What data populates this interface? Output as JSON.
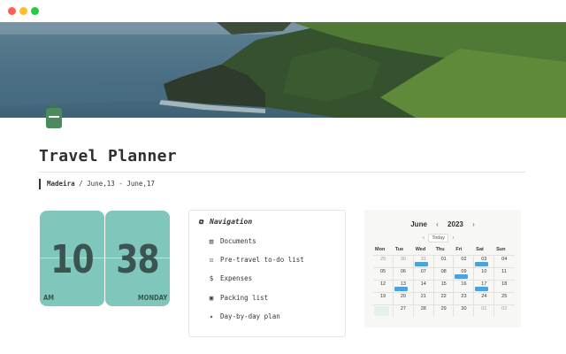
{
  "window": {
    "controls": [
      "close",
      "minimize",
      "zoom"
    ]
  },
  "cover": {
    "image": "coastal-cliffs-photo"
  },
  "page": {
    "icon": "backpack-icon",
    "title": "Travel Planner",
    "destination": "Madeira",
    "dates": " / June,13 - June,17"
  },
  "clock": {
    "hours": "10",
    "minutes": "38",
    "period": "AM",
    "day": "MONDAY"
  },
  "navigation": {
    "heading": "Navigation",
    "items": [
      {
        "label": "Documents",
        "icon": "document-icon"
      },
      {
        "label": "Pre-travel to-do list",
        "icon": "checklist-icon"
      },
      {
        "label": "Expenses",
        "icon": "money-bag-icon"
      },
      {
        "label": "Packing list",
        "icon": "luggage-icon"
      },
      {
        "label": "Day-by-day plan",
        "icon": "sparkle-icon"
      }
    ]
  },
  "calendar": {
    "month": "June",
    "year": "2023",
    "prev": "‹",
    "next": "›",
    "today_label": "Today",
    "weekdays": [
      "Mon",
      "Tue",
      "Wed",
      "Thu",
      "Fri",
      "Sat",
      "Sun"
    ],
    "weeks": [
      [
        "29",
        "30",
        "31",
        "01",
        "02",
        "03",
        "04"
      ],
      [
        "05",
        "06",
        "07",
        "08",
        "09",
        "10",
        "11"
      ],
      [
        "12",
        "13",
        "14",
        "15",
        "16",
        "17",
        "18"
      ],
      [
        "19",
        "20",
        "21",
        "22",
        "23",
        "24",
        "25"
      ],
      [
        "26",
        "27",
        "28",
        "29",
        "30",
        "01",
        "02"
      ]
    ]
  },
  "colors": {
    "clock_card": "#7fc7ba",
    "event": "#4aa3df",
    "accent_green": "#4a8a5c"
  }
}
